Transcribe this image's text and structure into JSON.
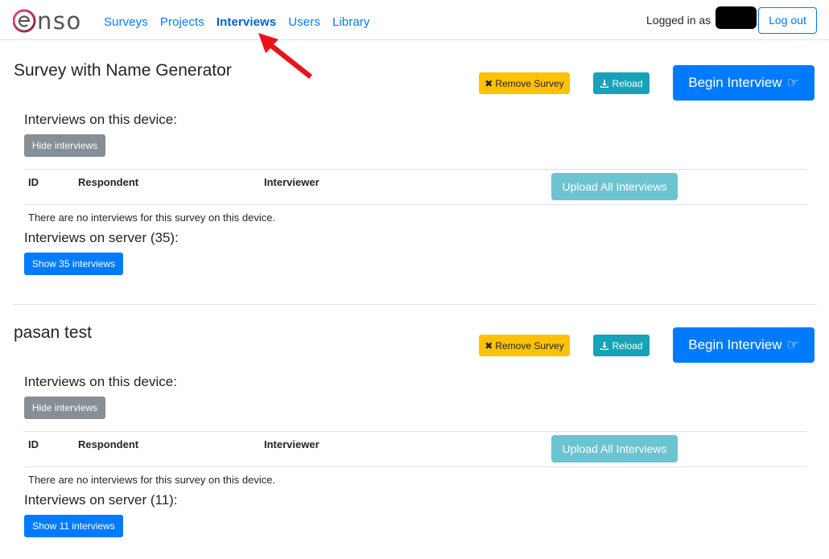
{
  "nav": {
    "brand": "enso",
    "links": [
      "Surveys",
      "Projects",
      "Interviews",
      "Users",
      "Library"
    ],
    "active_index": 2,
    "logged_in_label": "Logged in as",
    "logout_label": "Log out"
  },
  "colors": {
    "primary": "#007bff",
    "warning": "#ffc107",
    "info": "#17a2b8",
    "secondary": "#868e96",
    "annotation_arrow": "#e8131b"
  },
  "surveys": [
    {
      "title": "Survey with Name Generator",
      "remove_label": "Remove Survey",
      "reload_label": "Reload",
      "begin_label": "Begin Interview",
      "device_heading": "Interviews on this device:",
      "hide_label": "Hide interviews",
      "columns": [
        "ID",
        "Respondent",
        "Interviewer"
      ],
      "upload_label": "Upload All Interviews",
      "empty_message": "There are no interviews for this survey on this device.",
      "server_heading": "Interviews on server (35):",
      "show_label": "Show 35 interviews"
    },
    {
      "title": "pasan test",
      "remove_label": "Remove Survey",
      "reload_label": "Reload",
      "begin_label": "Begin Interview",
      "device_heading": "Interviews on this device:",
      "hide_label": "Hide interviews",
      "columns": [
        "ID",
        "Respondent",
        "Interviewer"
      ],
      "upload_label": "Upload All Interviews",
      "empty_message": "There are no interviews for this survey on this device.",
      "server_heading": "Interviews on server (11):",
      "show_label": "Show 11 interviews"
    }
  ]
}
